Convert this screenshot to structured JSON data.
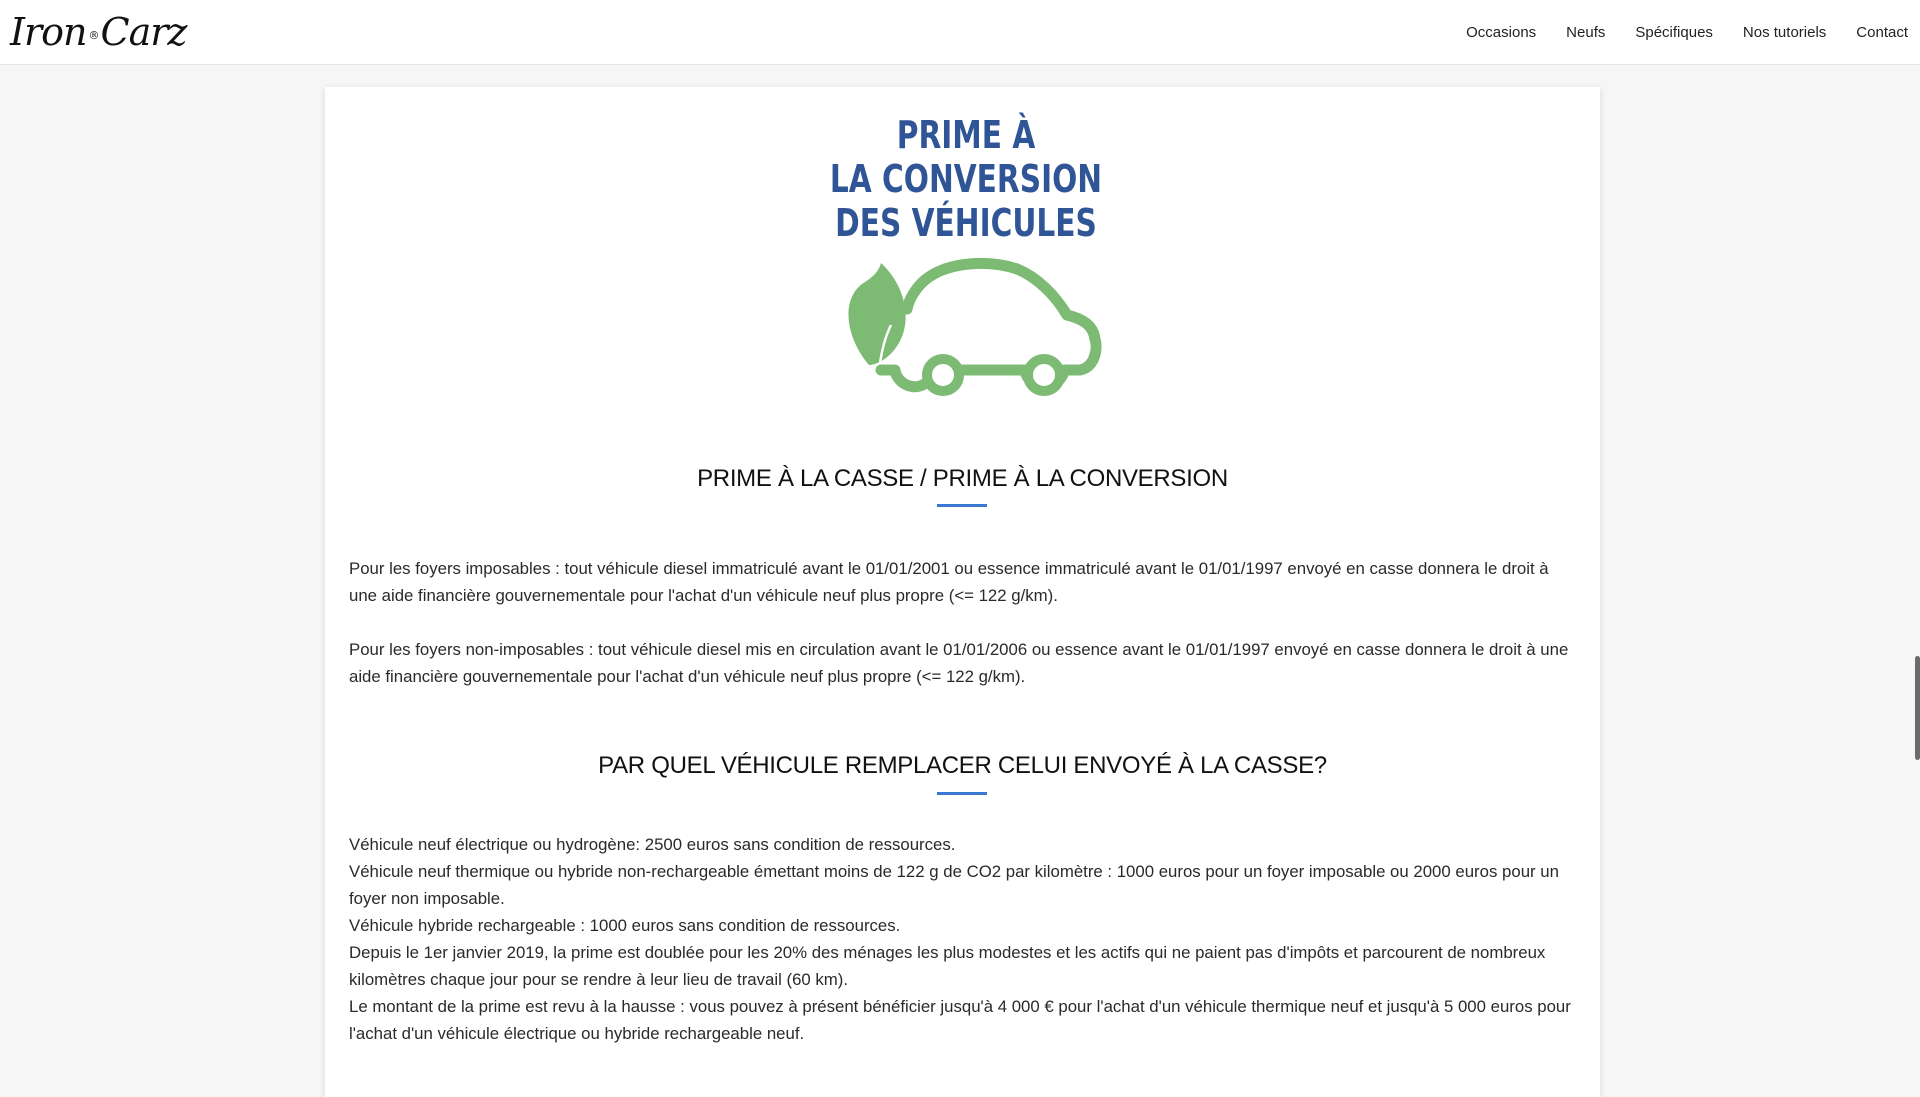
{
  "header": {
    "logo": {
      "part1": "Iron",
      "mark": "®",
      "part2": "Carz"
    },
    "nav": [
      "Occasions",
      "Neufs",
      "Spécifiques",
      "Nos tutoriels",
      "Contact"
    ]
  },
  "banner": {
    "line1": "PRIME À",
    "line2": "LA CONVERSION",
    "line3": "DES VÉHICULES",
    "title_color": "#2f5597",
    "icon_color": "#7dbb74",
    "icon": "eco-car-leaf-icon"
  },
  "section1": {
    "title": "PRIME À LA CASSE / PRIME À LA CONVERSION",
    "paragraphs": [
      "Pour les foyers imposables : tout véhicule diesel immatriculé avant le 01/01/2001 ou essence immatriculé avant le 01/01/1997 envoyé en casse donnera le droit à une aide financière gouvernementale pour l'achat d'un véhicule neuf plus propre (<= 122 g/km).",
      "Pour les foyers non-imposables : tout véhicule diesel mis en circulation avant le 01/01/2006 ou essence avant le 01/01/1997 envoyé en casse donnera le droit à une aide financière gouvernementale pour l'achat d'un véhicule neuf plus propre (<= 122 g/km)."
    ]
  },
  "section2": {
    "title": "PAR QUEL VÉHICULE REMPLACER CELUI ENVOYÉ À LA CASSE?",
    "lines": [
      "Véhicule neuf électrique ou hydrogène: 2500 euros sans condition de ressources.",
      "Véhicule neuf thermique ou hybride non-rechargeable émettant moins de 122 g de CO2 par kilomètre : 1000 euros pour un foyer imposable ou 2000 euros pour un foyer non imposable.",
      "Véhicule hybride rechargeable : 1000 euros sans condition de ressources.",
      "Depuis le 1er janvier 2019, la prime est doublée pour les 20% des ménages les plus modestes et les actifs qui ne paient pas d'impôts et parcourent de nombreux kilomètres chaque jour pour se rendre à leur lieu de travail (60 km).",
      "Le montant de la prime est revu à la hausse : vous pouvez à présent bénéficier jusqu'à 4 000 € pour l'achat d'un véhicule thermique neuf et jusqu'à 5 000 euros pour l'achat d'un véhicule électrique ou hybride rechargeable neuf."
    ]
  },
  "accent_color": "#3b78d4"
}
